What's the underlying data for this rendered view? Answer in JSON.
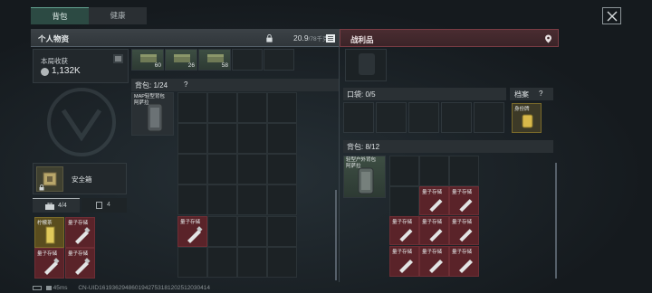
{
  "tabs": [
    {
      "label": "背包",
      "active": true
    },
    {
      "label": "健康",
      "active": false
    }
  ],
  "personal": {
    "title": "个人物资",
    "weight_current": "20.9",
    "weight_capacity": "/78千克",
    "ammo": [
      {
        "count": "60"
      },
      {
        "count": "26"
      },
      {
        "count": "58"
      }
    ],
    "earnings_label": "本局收获",
    "earnings_value": "1,132K",
    "backpack_label": "背包: 1/24",
    "backpack_help": "?",
    "backpack_item_label": "MAP轻型背包\n阿萨拉",
    "safe_box_label": "安全箱",
    "tab_count_a": "4/4",
    "tab_count_b": "4",
    "pocket_items": [
      {
        "label": "柠檬茶"
      },
      {
        "label": "量子存储"
      },
      {
        "label": "量子存储"
      },
      {
        "label": "量子存储"
      }
    ],
    "grid_item_label": "量子存储"
  },
  "loot": {
    "title": "战利品",
    "pocket_label": "口袋: 0/5",
    "archive_label": "档案",
    "archive_help": "?",
    "archive_item_label": "身份牌",
    "backpack_label": "背包: 8/12",
    "backpack_item_label": "轻型户外背包\n阿萨拉",
    "quantum_items": [
      {
        "label": "量子存储"
      },
      {
        "label": "量子存储"
      },
      {
        "label": "量子存储"
      },
      {
        "label": "量子存储"
      },
      {
        "label": "量子存储"
      },
      {
        "label": "量子存储"
      },
      {
        "label": "量子存储"
      },
      {
        "label": "量子存储"
      }
    ]
  },
  "status": {
    "ping": "45ms",
    "uid": "CN-UID1619362948601942753181202512030414"
  },
  "colors": {
    "accent_green": "#63a392",
    "loot_red": "#7a3c44",
    "item_red": "#5a2329"
  }
}
